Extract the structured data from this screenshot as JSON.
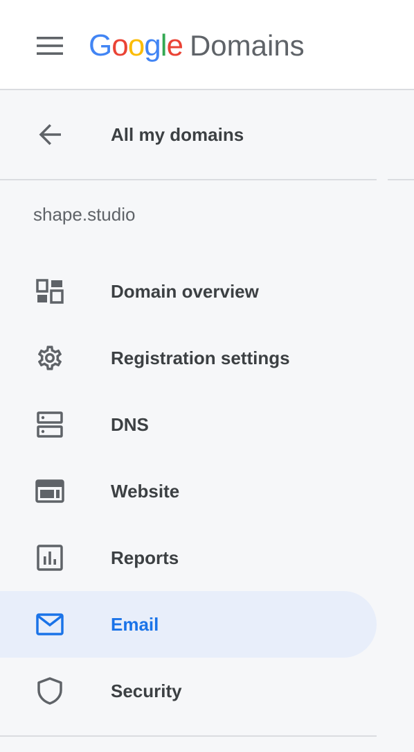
{
  "header": {
    "brand_google": [
      "G",
      "o",
      "o",
      "g",
      "l",
      "e"
    ],
    "brand_product": "Domains",
    "brand_colors": [
      "#4285f4",
      "#ea4335",
      "#fbbc05",
      "#4285f4",
      "#34a853",
      "#ea4335"
    ]
  },
  "nav": {
    "back_label": "All my domains",
    "domain_name": "shape.studio",
    "items": [
      {
        "label": "Domain overview",
        "icon": "dashboard-icon",
        "active": false
      },
      {
        "label": "Registration settings",
        "icon": "gear-icon",
        "active": false
      },
      {
        "label": "DNS",
        "icon": "dns-icon",
        "active": false
      },
      {
        "label": "Website",
        "icon": "website-icon",
        "active": false
      },
      {
        "label": "Reports",
        "icon": "reports-icon",
        "active": false
      },
      {
        "label": "Email",
        "icon": "email-icon",
        "active": true
      },
      {
        "label": "Security",
        "icon": "shield-icon",
        "active": false
      }
    ]
  },
  "colors": {
    "accent": "#1a73e8",
    "active_bg": "#e8eefa",
    "icon": "#5f6368",
    "text": "#3c4043"
  }
}
